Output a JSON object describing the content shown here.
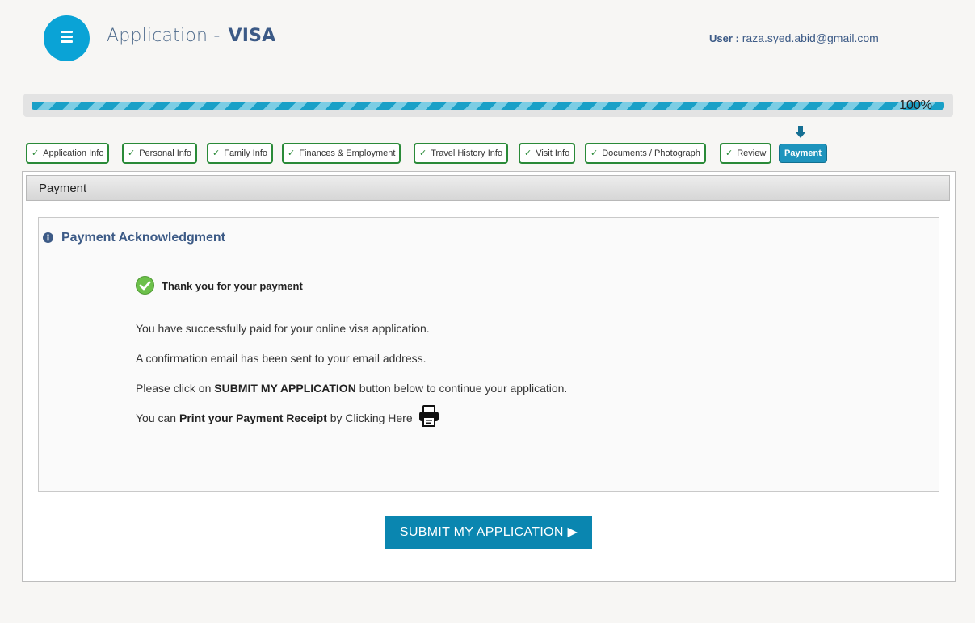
{
  "header": {
    "menu_icon": "hamburger-menu-icon",
    "title_prefix": "Application -",
    "title_strong": "VISA",
    "user_label": "User :",
    "user_email": "raza.syed.abid@gmail.com"
  },
  "progress": {
    "percent": 100,
    "label": "100%"
  },
  "steps": [
    {
      "label": "Application Info",
      "completed": true
    },
    {
      "label": "Personal Info",
      "completed": true
    },
    {
      "label": "Family Info",
      "completed": true
    },
    {
      "label": "Finances & Employment",
      "completed": true
    },
    {
      "label": "Travel History Info",
      "completed": true
    },
    {
      "label": "Visit Info",
      "completed": true
    },
    {
      "label": "Documents / Photograph",
      "completed": true
    },
    {
      "label": "Review",
      "completed": true
    },
    {
      "label": "Payment",
      "active": true
    }
  ],
  "step_check": "✓",
  "panel": {
    "title": "Payment",
    "ack_title": "Payment Acknowledgment",
    "thanks": "Thank you for your payment",
    "line1": "You have successfully paid for your online visa application.",
    "line2": "A confirmation email has been sent to your email address.",
    "line3_pre": "Please click on ",
    "line3_bold": "SUBMIT MY APPLICATION",
    "line3_post": " button below to continue your application.",
    "line4_pre": "You can ",
    "line4_bold": "Print your Payment Receipt",
    "line4_post": " by Clicking Here"
  },
  "submit_button": "SUBMIT MY APPLICATION ▶",
  "colors": {
    "brand": "#0aa3d6",
    "title": "#3c5a86",
    "step_border": "#2a8a38",
    "active_step": "#1e94bd",
    "button": "#0a86b0"
  }
}
